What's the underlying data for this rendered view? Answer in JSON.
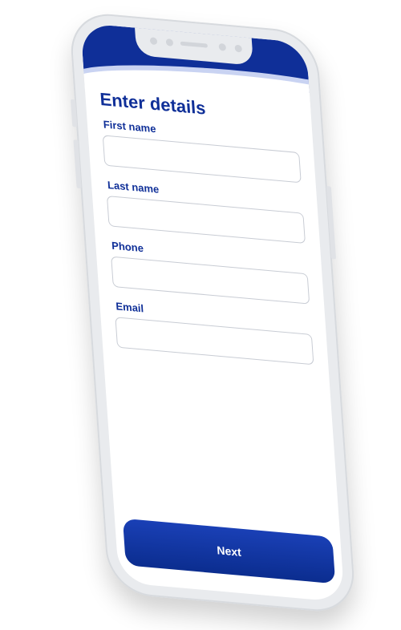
{
  "form": {
    "title": "Enter details",
    "fields": [
      {
        "label": "First name",
        "value": "",
        "placeholder": ""
      },
      {
        "label": "Last name",
        "value": "",
        "placeholder": ""
      },
      {
        "label": "Phone",
        "value": "",
        "placeholder": ""
      },
      {
        "label": "Email",
        "value": "",
        "placeholder": ""
      }
    ],
    "next_label": "Next"
  },
  "colors": {
    "brand": "#0f2f98",
    "phone_frame": "#e9ebee",
    "input_border": "#c8ccd4"
  }
}
